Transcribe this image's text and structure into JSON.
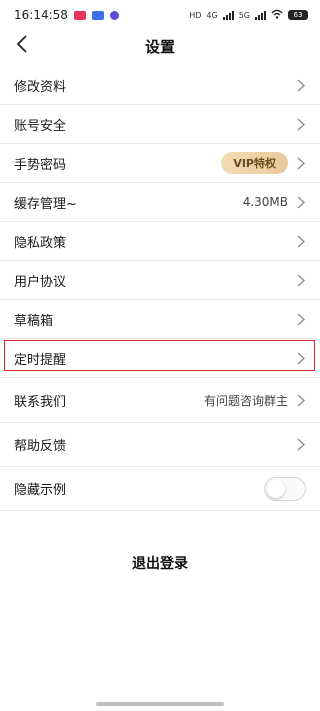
{
  "status_bar": {
    "time": "16:14:58",
    "network_labels": [
      "HD",
      "4G",
      "5G"
    ],
    "battery": "63"
  },
  "header": {
    "title": "设置",
    "back_icon": "chevron-left-icon"
  },
  "settings": {
    "items": [
      {
        "label": "修改资料"
      },
      {
        "label": "账号安全"
      },
      {
        "label": "手势密码",
        "badge": "VIP特权"
      },
      {
        "label": "缓存管理~",
        "value": "4.30MB"
      },
      {
        "label": "隐私政策"
      },
      {
        "label": "用户协议"
      },
      {
        "label": "草稿箱"
      },
      {
        "label": "定时提醒"
      },
      {
        "label": "联系我们",
        "value": "有问题咨询群主"
      },
      {
        "label": "帮助反馈"
      },
      {
        "label": "隐藏示例",
        "toggle": false
      }
    ]
  },
  "logout_label": "退出登录",
  "colors": {
    "highlight_border": "#d62828",
    "vip_badge_bg": "#f3dcb6",
    "vip_badge_text": "#6b4a1f"
  }
}
